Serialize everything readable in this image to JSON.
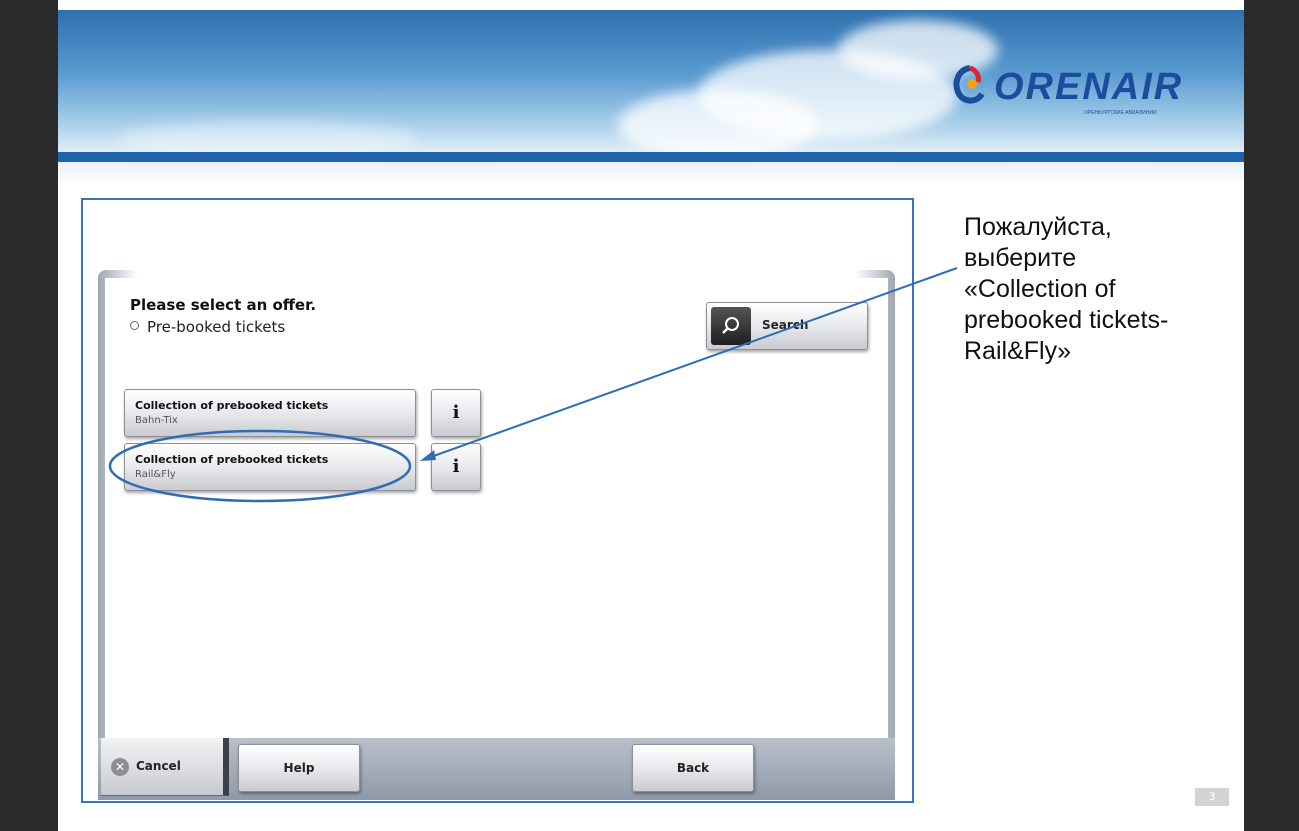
{
  "brand": {
    "name": "ORENAIR",
    "tagline": "ОРЕНБУРГСКИЕ АВИАЛИНИИ"
  },
  "kiosk": {
    "title": "Please select an offer.",
    "breadcrumb": "Pre-booked tickets",
    "search_label": "Search",
    "offers": [
      {
        "line1": "Collection of prebooked tickets",
        "line2": "Bahn-Tix",
        "info": "i"
      },
      {
        "line1": "Collection of prebooked tickets",
        "line2": "Rail&Fly",
        "info": "i"
      }
    ],
    "cancel_label": "Cancel",
    "help_label": "Help",
    "back_label": "Back"
  },
  "callout": {
    "lines": [
      "Пожалуйста,",
      "выберите",
      "«Collection of",
      "prebooked tickets-",
      "Rail&Fly»"
    ]
  },
  "page_number": "3",
  "colors": {
    "frame": "#3a73b8",
    "arrow": "#2e6db4",
    "brand_blue": "#1a4e9c"
  }
}
